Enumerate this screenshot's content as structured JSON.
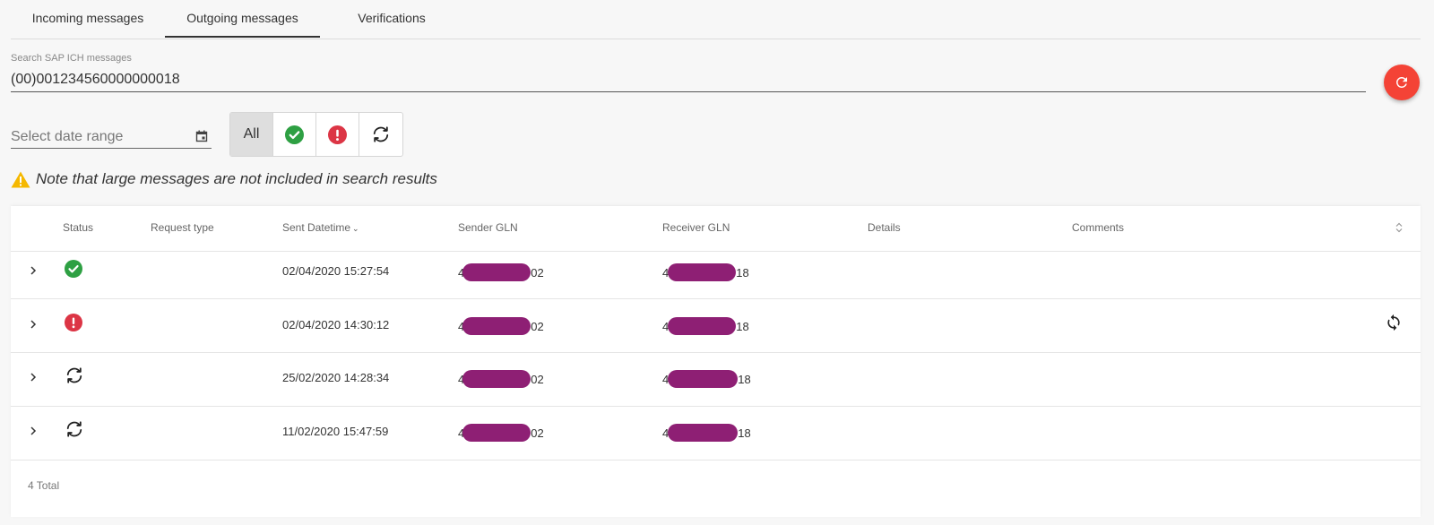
{
  "tabs": [
    {
      "label": "Incoming messages"
    },
    {
      "label": "Outgoing messages"
    },
    {
      "label": "Verifications"
    }
  ],
  "search": {
    "label": "Search SAP ICH messages",
    "value": "(00)001234560000000018"
  },
  "date_range": {
    "placeholder": "Select date range"
  },
  "filters": {
    "all_label": "All"
  },
  "note": {
    "text": "Note that large messages are not included in search results"
  },
  "table": {
    "headers": {
      "status": "Status",
      "request_type": "Request type",
      "sent_datetime": "Sent Datetime",
      "sender_gln": "Sender GLN",
      "receiver_gln": "Receiver GLN",
      "details": "Details",
      "comments": "Comments"
    },
    "rows": [
      {
        "status": "success",
        "sent": "02/04/2020 15:27:54",
        "sender_prefix": "4",
        "sender_suffix": "02",
        "receiver_prefix": "4",
        "receiver_suffix": "18"
      },
      {
        "status": "error",
        "sent": "02/04/2020 14:30:12",
        "sender_prefix": "4",
        "sender_suffix": "02",
        "receiver_prefix": "4",
        "receiver_suffix": "18"
      },
      {
        "status": "processing",
        "sent": "25/02/2020 14:28:34",
        "sender_prefix": "4",
        "sender_suffix": "02",
        "receiver_prefix": "4",
        "receiver_suffix": "18"
      },
      {
        "status": "processing",
        "sent": "11/02/2020 15:47:59",
        "sender_prefix": "4",
        "sender_suffix": "02",
        "receiver_prefix": "4",
        "receiver_suffix": "18"
      }
    ],
    "total": "4 Total"
  },
  "colors": {
    "accent_red": "#f44336",
    "success": "#2ea043",
    "error": "#dc3545",
    "redaction": "#8e1f74"
  }
}
